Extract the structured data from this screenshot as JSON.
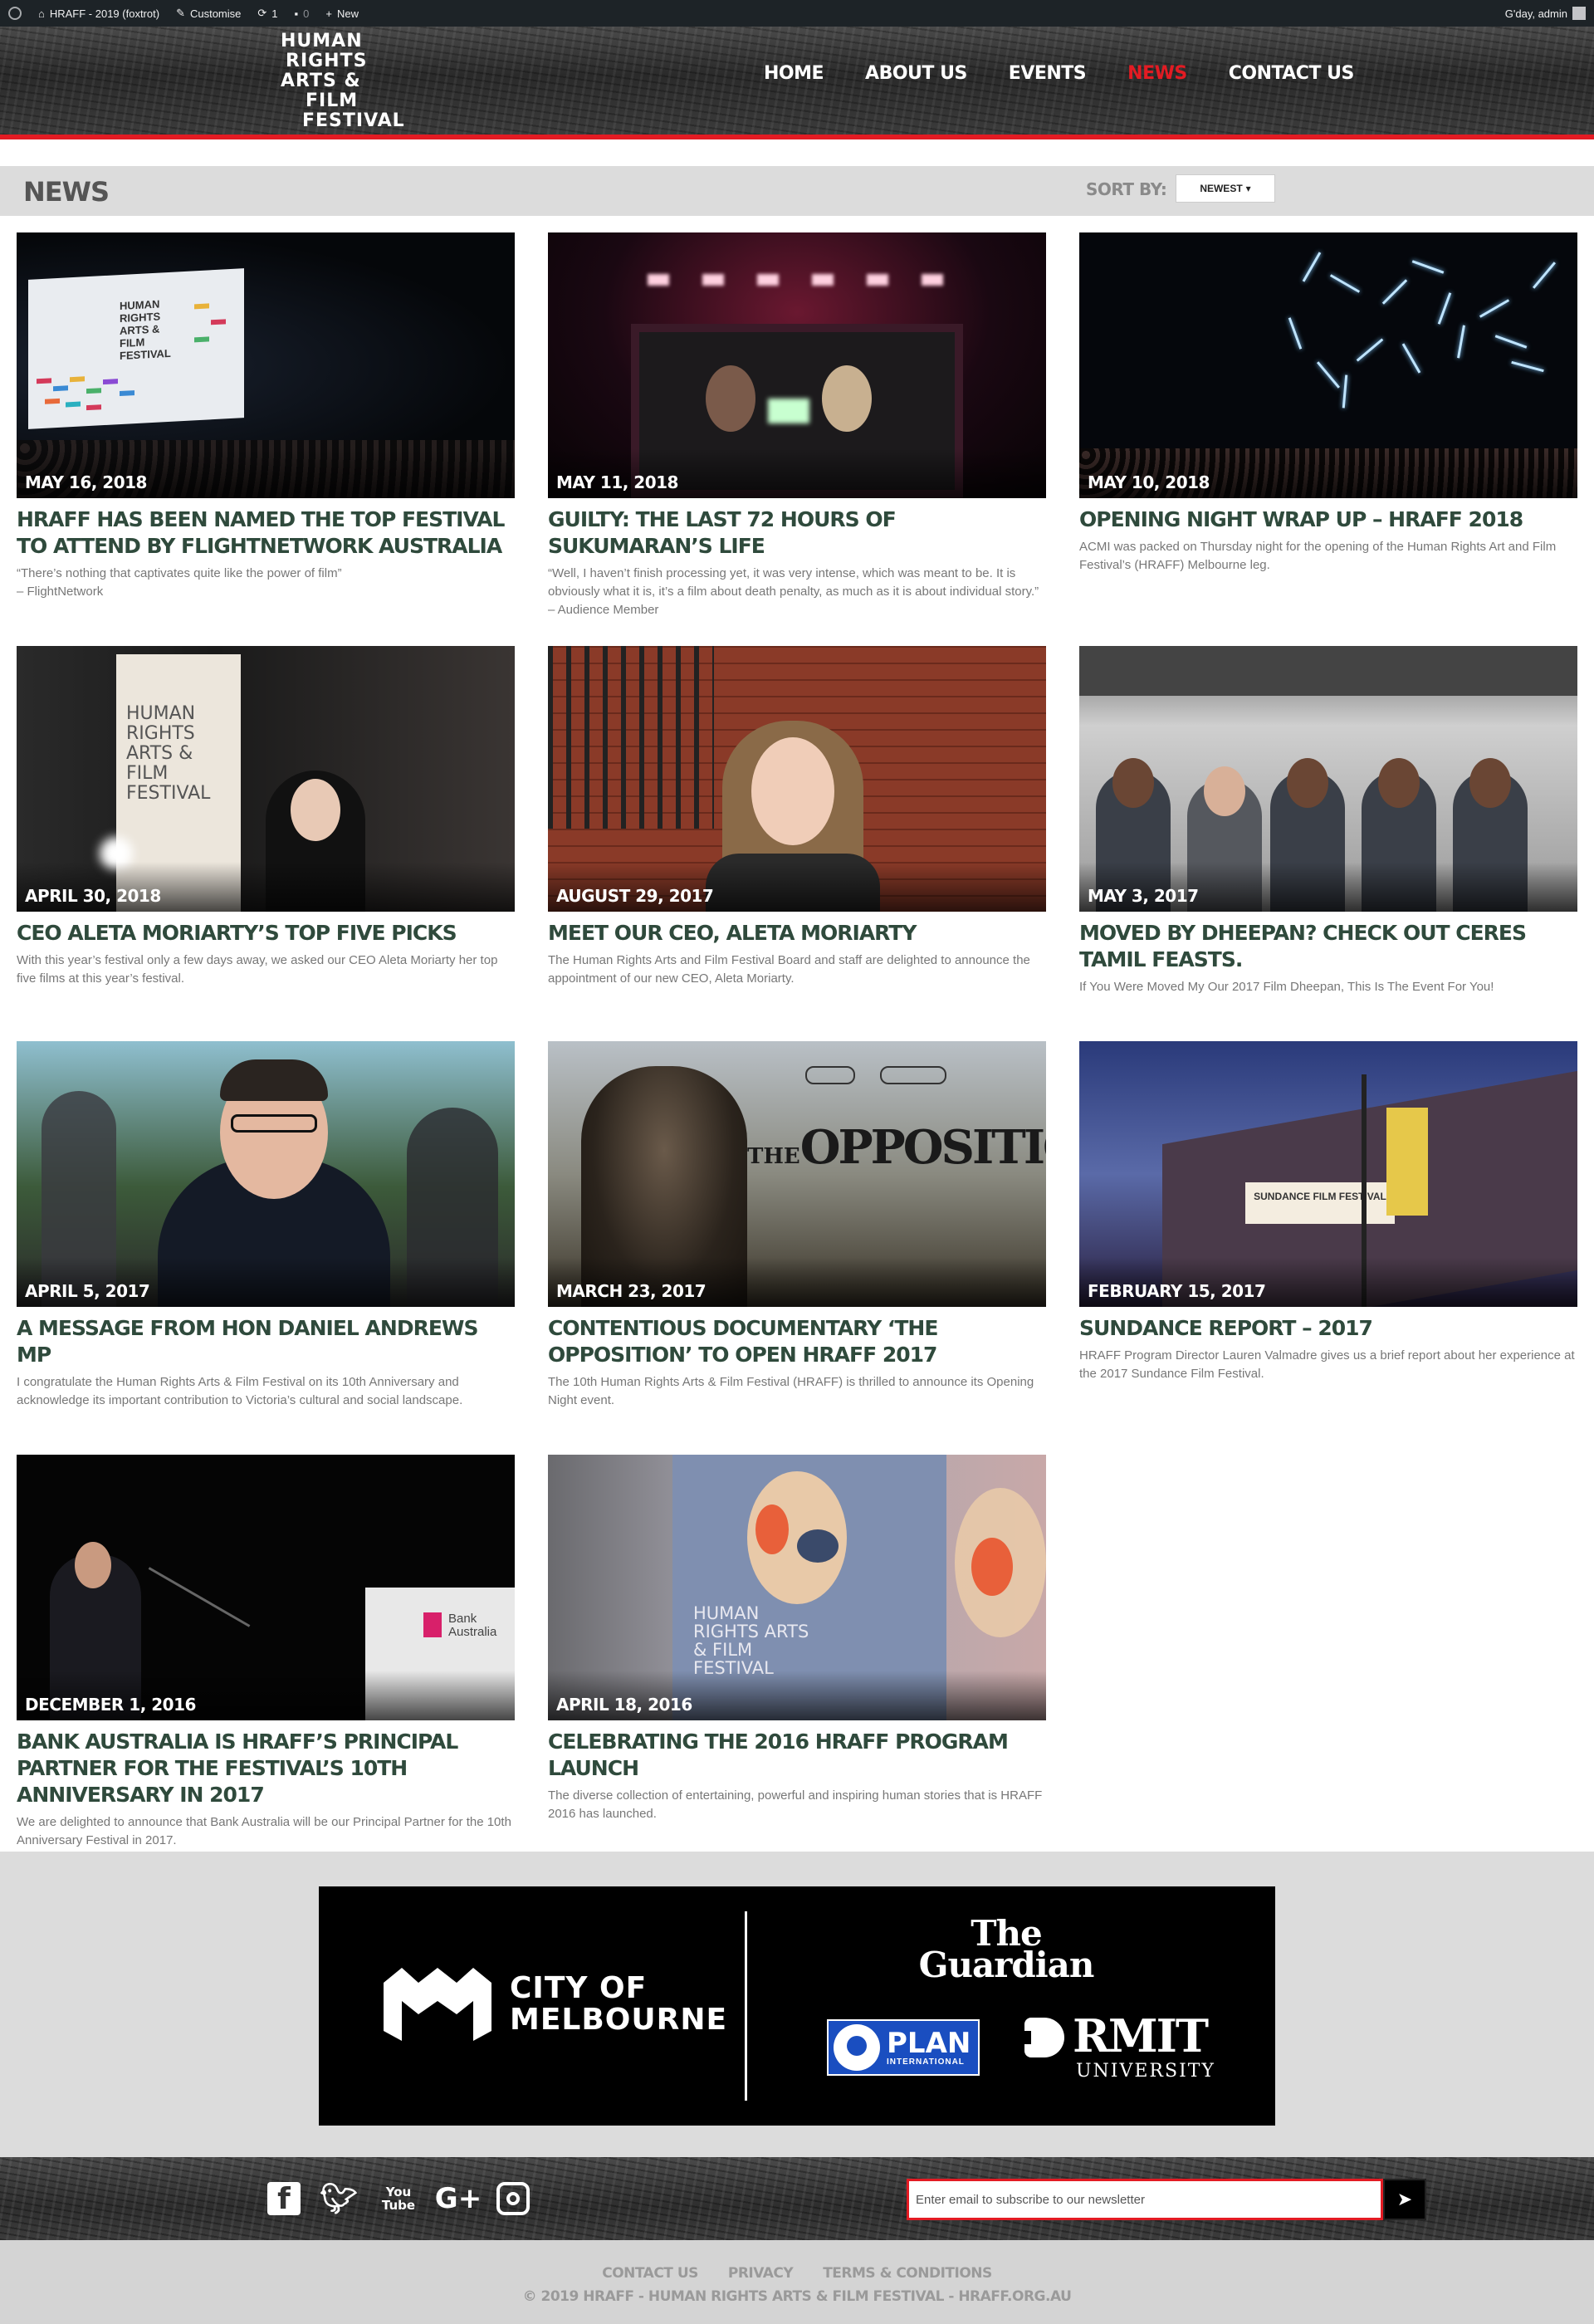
{
  "adminbar": {
    "site_name": "HRAFF - 2019 (foxtrot)",
    "customise": "Customise",
    "updates_count": "1",
    "comments_count": "0",
    "new_label": "New",
    "greeting": "G'day, admin"
  },
  "logo": {
    "line1": "HUMAN",
    "line2": "RIGHTS",
    "line3": "ARTS &",
    "line4": "FILM",
    "line5": "FESTIVAL"
  },
  "nav": {
    "home": "HOME",
    "about": "ABOUT US",
    "events": "EVENTS",
    "news": "NEWS",
    "contact": "CONTACT US"
  },
  "colors": {
    "accent": "#e31b23",
    "heading": "#2f4a3c"
  },
  "page": {
    "title": "NEWS",
    "sort_label": "SORT BY:",
    "sort_value": "NEWEST"
  },
  "cards": [
    {
      "date": "MAY 16, 2018",
      "title": "HRAFF HAS BEEN NAMED THE TOP FESTIVAL TO ATTEND BY FLIGHTNETWORK AUSTRALIA",
      "excerpt": "“There’s nothing that captivates quite like the power of film”",
      "excerpt2": "– FlightNetwork",
      "thumb_text": "HUMAN RIGHTS ARTS & FILM FESTIVAL"
    },
    {
      "date": "MAY 11, 2018",
      "title": "GUILTY: THE LAST 72 HOURS OF SUKUMARAN’S LIFE",
      "excerpt": "“Well, I haven’t finish processing yet, it was very intense, which was meant to be. It is obviously what it is, it’s a film about death penalty, as much as it is about individual story.” – Audience Member"
    },
    {
      "date": "MAY 10, 2018",
      "title": "OPENING NIGHT WRAP UP – HRAFF 2018",
      "excerpt": "ACMI was packed on Thursday night for the opening of the Human Rights Art and Film Festival’s (HRAFF) Melbourne leg."
    },
    {
      "date": "APRIL 30, 2018",
      "title": "CEO ALETA MORIARTY’S TOP FIVE PICKS",
      "excerpt": "With this year’s festival only a few days away, we asked our CEO Aleta Moriarty her top five films at this year’s festival.",
      "thumb_text": "HUMAN RIGHTS ARTS & FILM FESTIVAL"
    },
    {
      "date": "AUGUST 29, 2017",
      "title": "MEET OUR CEO, ALETA MORIARTY",
      "excerpt": "The Human Rights Arts and Film Festival Board and staff are delighted to announce the appointment of our new CEO, Aleta Moriarty."
    },
    {
      "date": "MAY 3, 2017",
      "title": "MOVED BY DHEEPAN? CHECK OUT CERES TAMIL FEASTS.",
      "excerpt": "If You Were Moved My Our 2017 Film Dheepan, This Is The Event For You!"
    },
    {
      "date": "APRIL 5, 2017",
      "title": "A MESSAGE FROM HON DANIEL ANDREWS MP",
      "excerpt": "I congratulate the Human Rights Arts & Film Festival on its 10th Anniversary and acknowledge its important contribution to Victoria’s cultural and social landscape."
    },
    {
      "date": "MARCH 23, 2017",
      "title": "CONTENTIOUS DOCUMENTARY ‘THE OPPOSITION’ TO OPEN HRAFF 2017",
      "excerpt": "The 10th Human Rights Arts & Film Festival (HRAFF) is thrilled to announce its Opening Night event.",
      "thumb_text": "THE",
      "thumb_text2": "OPPOSITION"
    },
    {
      "date": "FEBRUARY 15, 2017",
      "title": "SUNDANCE REPORT – 2017",
      "excerpt": "HRAFF Program Director Lauren Valmadre gives us a brief report about her experience at the 2017 Sundance Film Festival.",
      "thumb_text": "SUNDANCE FILM FESTIVAL"
    },
    {
      "date": "DECEMBER 1, 2016",
      "title": "BANK AUSTRALIA IS HRAFF’S PRINCIPAL PARTNER FOR THE FESTIVAL’S 10TH ANNIVERSARY IN 2017",
      "excerpt": "We are delighted to announce that Bank Australia will be our Principal Partner for the 10th Anniversary Festival in 2017.",
      "thumb_text": "Bank Australia"
    },
    {
      "date": "APRIL 18, 2016",
      "title": "CELEBRATING THE 2016 HRAFF PROGRAM LAUNCH",
      "excerpt": "The diverse collection of entertaining, powerful and inspiring human stories that is HRAFF 2016 has launched.",
      "thumb_text": "HUMAN RIGHTS ARTS & FILM FESTIVAL"
    }
  ],
  "sponsors": {
    "city_line1": "CITY OF",
    "city_line2": "MELBOURNE",
    "guardian_line1": "The",
    "guardian_line2": "Guardian",
    "plan_name": "PLAN",
    "plan_sub": "INTERNATIONAL",
    "rmit_name": "RMIT",
    "rmit_sub": "UNIVERSITY"
  },
  "footer": {
    "newsletter_placeholder": "Enter email to subscribe to our newsletter",
    "youtube_line1": "You",
    "youtube_line2": "Tube",
    "links": [
      "CONTACT US",
      "PRIVACY",
      "TERMS & CONDITIONS"
    ],
    "copyright": "© 2019 HRAFF - HUMAN RIGHTS ARTS & FILM FESTIVAL - HRAFF.ORG.AU"
  }
}
